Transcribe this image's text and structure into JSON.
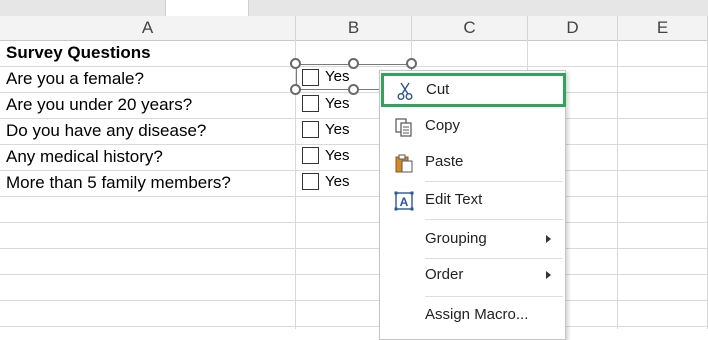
{
  "columns": [
    "A",
    "B",
    "C",
    "D",
    "E"
  ],
  "cells": {
    "header": "Survey Questions",
    "questions": [
      "Are you a female?",
      "Are you under 20 years?",
      "Do you have any disease?",
      "Any medical history?",
      "More than 5 family members?"
    ]
  },
  "checkboxes": [
    "Yes",
    "Yes",
    "Yes",
    "Yes",
    "Yes"
  ],
  "context_menu": {
    "items": [
      {
        "label": "Cut",
        "icon": "scissors-icon"
      },
      {
        "label": "Copy",
        "icon": "copy-icon"
      },
      {
        "label": "Paste",
        "icon": "paste-icon"
      },
      {
        "label": "Edit Text",
        "icon": "edit-text-icon"
      },
      {
        "label": "Grouping",
        "icon": ""
      },
      {
        "label": "Order",
        "icon": ""
      },
      {
        "label": "Assign Macro...",
        "icon": ""
      }
    ]
  },
  "colors": {
    "focus_border": "#2ea55b",
    "icon_blue": "#2b579a",
    "paste_orange": "#d08a2a"
  }
}
